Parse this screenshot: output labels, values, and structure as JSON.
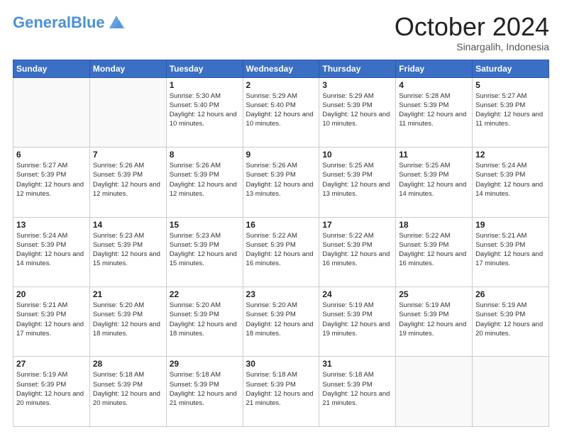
{
  "header": {
    "logo_general": "General",
    "logo_blue": "Blue",
    "month_title": "October 2024",
    "subtitle": "Sinargalih, Indonesia"
  },
  "days_of_week": [
    "Sunday",
    "Monday",
    "Tuesday",
    "Wednesday",
    "Thursday",
    "Friday",
    "Saturday"
  ],
  "weeks": [
    [
      {
        "day": "",
        "info": ""
      },
      {
        "day": "",
        "info": ""
      },
      {
        "day": "1",
        "info": "Sunrise: 5:30 AM\nSunset: 5:40 PM\nDaylight: 12 hours and 10 minutes."
      },
      {
        "day": "2",
        "info": "Sunrise: 5:29 AM\nSunset: 5:40 PM\nDaylight: 12 hours and 10 minutes."
      },
      {
        "day": "3",
        "info": "Sunrise: 5:29 AM\nSunset: 5:39 PM\nDaylight: 12 hours and 10 minutes."
      },
      {
        "day": "4",
        "info": "Sunrise: 5:28 AM\nSunset: 5:39 PM\nDaylight: 12 hours and 11 minutes."
      },
      {
        "day": "5",
        "info": "Sunrise: 5:27 AM\nSunset: 5:39 PM\nDaylight: 12 hours and 11 minutes."
      }
    ],
    [
      {
        "day": "6",
        "info": "Sunrise: 5:27 AM\nSunset: 5:39 PM\nDaylight: 12 hours and 12 minutes."
      },
      {
        "day": "7",
        "info": "Sunrise: 5:26 AM\nSunset: 5:39 PM\nDaylight: 12 hours and 12 minutes."
      },
      {
        "day": "8",
        "info": "Sunrise: 5:26 AM\nSunset: 5:39 PM\nDaylight: 12 hours and 12 minutes."
      },
      {
        "day": "9",
        "info": "Sunrise: 5:26 AM\nSunset: 5:39 PM\nDaylight: 12 hours and 13 minutes."
      },
      {
        "day": "10",
        "info": "Sunrise: 5:25 AM\nSunset: 5:39 PM\nDaylight: 12 hours and 13 minutes."
      },
      {
        "day": "11",
        "info": "Sunrise: 5:25 AM\nSunset: 5:39 PM\nDaylight: 12 hours and 14 minutes."
      },
      {
        "day": "12",
        "info": "Sunrise: 5:24 AM\nSunset: 5:39 PM\nDaylight: 12 hours and 14 minutes."
      }
    ],
    [
      {
        "day": "13",
        "info": "Sunrise: 5:24 AM\nSunset: 5:39 PM\nDaylight: 12 hours and 14 minutes."
      },
      {
        "day": "14",
        "info": "Sunrise: 5:23 AM\nSunset: 5:39 PM\nDaylight: 12 hours and 15 minutes."
      },
      {
        "day": "15",
        "info": "Sunrise: 5:23 AM\nSunset: 5:39 PM\nDaylight: 12 hours and 15 minutes."
      },
      {
        "day": "16",
        "info": "Sunrise: 5:22 AM\nSunset: 5:39 PM\nDaylight: 12 hours and 16 minutes."
      },
      {
        "day": "17",
        "info": "Sunrise: 5:22 AM\nSunset: 5:39 PM\nDaylight: 12 hours and 16 minutes."
      },
      {
        "day": "18",
        "info": "Sunrise: 5:22 AM\nSunset: 5:39 PM\nDaylight: 12 hours and 16 minutes."
      },
      {
        "day": "19",
        "info": "Sunrise: 5:21 AM\nSunset: 5:39 PM\nDaylight: 12 hours and 17 minutes."
      }
    ],
    [
      {
        "day": "20",
        "info": "Sunrise: 5:21 AM\nSunset: 5:39 PM\nDaylight: 12 hours and 17 minutes."
      },
      {
        "day": "21",
        "info": "Sunrise: 5:20 AM\nSunset: 5:39 PM\nDaylight: 12 hours and 18 minutes."
      },
      {
        "day": "22",
        "info": "Sunrise: 5:20 AM\nSunset: 5:39 PM\nDaylight: 12 hours and 18 minutes."
      },
      {
        "day": "23",
        "info": "Sunrise: 5:20 AM\nSunset: 5:39 PM\nDaylight: 12 hours and 18 minutes."
      },
      {
        "day": "24",
        "info": "Sunrise: 5:19 AM\nSunset: 5:39 PM\nDaylight: 12 hours and 19 minutes."
      },
      {
        "day": "25",
        "info": "Sunrise: 5:19 AM\nSunset: 5:39 PM\nDaylight: 12 hours and 19 minutes."
      },
      {
        "day": "26",
        "info": "Sunrise: 5:19 AM\nSunset: 5:39 PM\nDaylight: 12 hours and 20 minutes."
      }
    ],
    [
      {
        "day": "27",
        "info": "Sunrise: 5:19 AM\nSunset: 5:39 PM\nDaylight: 12 hours and 20 minutes."
      },
      {
        "day": "28",
        "info": "Sunrise: 5:18 AM\nSunset: 5:39 PM\nDaylight: 12 hours and 20 minutes."
      },
      {
        "day": "29",
        "info": "Sunrise: 5:18 AM\nSunset: 5:39 PM\nDaylight: 12 hours and 21 minutes."
      },
      {
        "day": "30",
        "info": "Sunrise: 5:18 AM\nSunset: 5:39 PM\nDaylight: 12 hours and 21 minutes."
      },
      {
        "day": "31",
        "info": "Sunrise: 5:18 AM\nSunset: 5:39 PM\nDaylight: 12 hours and 21 minutes."
      },
      {
        "day": "",
        "info": ""
      },
      {
        "day": "",
        "info": ""
      }
    ]
  ]
}
